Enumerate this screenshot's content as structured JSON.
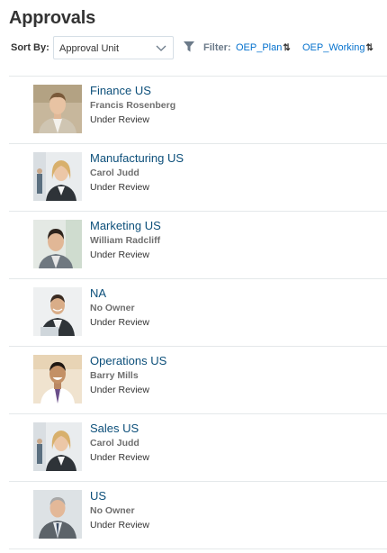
{
  "page": {
    "title": "Approvals"
  },
  "toolbar": {
    "sort_label": "Sort By:",
    "sort_value": "Approval Unit",
    "filter_label": "Filter:",
    "filters": [
      "OEP_Plan",
      "OEP_Working"
    ],
    "sync_glyph": "⇅"
  },
  "approvals": [
    {
      "unit": "Finance US",
      "owner": "Francis Rosenberg",
      "status": "Under Review"
    },
    {
      "unit": "Manufacturing US",
      "owner": "Carol Judd",
      "status": "Under Review"
    },
    {
      "unit": "Marketing US",
      "owner": "William Radcliff",
      "status": "Under Review"
    },
    {
      "unit": "NA",
      "owner": "No Owner",
      "status": "Under Review"
    },
    {
      "unit": "Operations US",
      "owner": "Barry Mills",
      "status": "Under Review"
    },
    {
      "unit": "Sales US",
      "owner": "Carol Judd",
      "status": "Under Review"
    },
    {
      "unit": "US",
      "owner": "No Owner",
      "status": "Under Review"
    }
  ],
  "colors": {
    "link": "#0572ce",
    "unit": "#0c4f7a",
    "divider": "#e4e8ea"
  }
}
